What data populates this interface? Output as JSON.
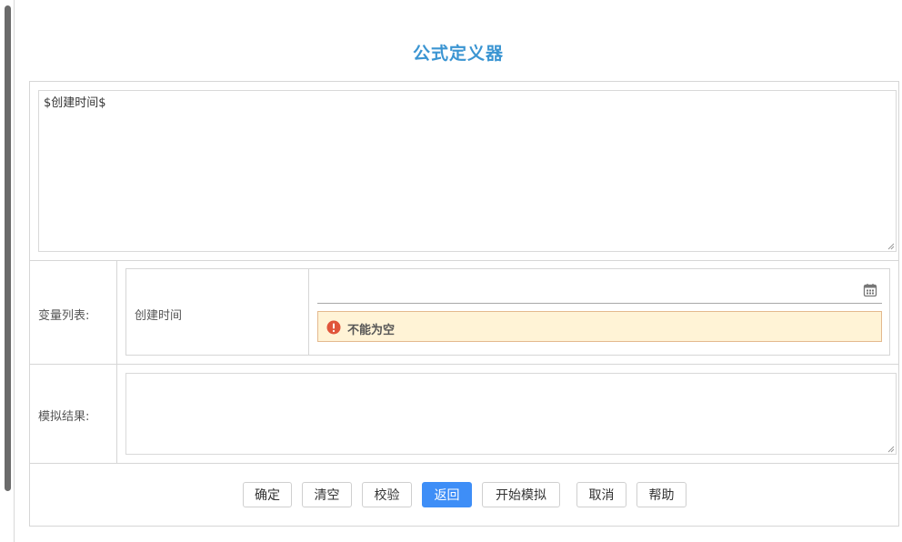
{
  "page": {
    "title": "公式定义器"
  },
  "formula": {
    "value": "$创建时间$"
  },
  "variables": {
    "label": "变量列表:",
    "items": [
      {
        "name": "创建时间",
        "value": "",
        "icon": "calendar-icon",
        "error": "不能为空"
      }
    ]
  },
  "simulation": {
    "label": "模拟结果:",
    "value": ""
  },
  "buttons": {
    "confirm": "确定",
    "clear": "清空",
    "validate": "校验",
    "back": "返回",
    "start_simulation": "开始模拟",
    "cancel": "取消",
    "help": "帮助"
  },
  "colors": {
    "title": "#3b95d2",
    "primary_button": "#3e8ef7",
    "error_bg": "#fff3d6",
    "error_icon": "#e0553b"
  }
}
